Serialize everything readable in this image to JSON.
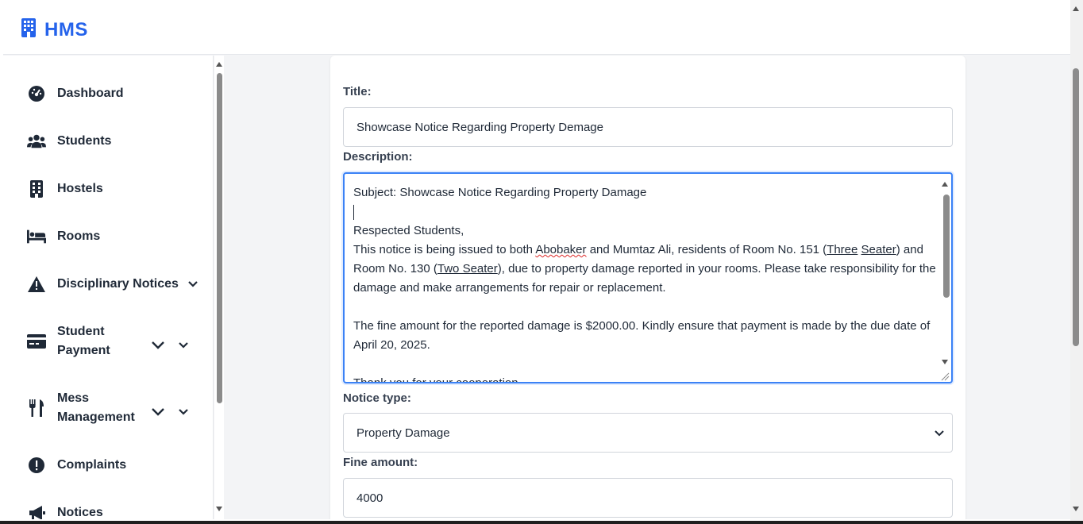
{
  "brand": {
    "name": "HMS",
    "icon": "building-icon",
    "color": "#2563eb"
  },
  "sidebar": {
    "items": [
      {
        "label": "Dashboard",
        "icon": "gauge-icon"
      },
      {
        "label": "Students",
        "icon": "users-icon"
      },
      {
        "label": "Hostels",
        "icon": "building-icon"
      },
      {
        "label": "Rooms",
        "icon": "bed-icon"
      },
      {
        "label": "Disciplinary Notices",
        "icon": "warning-icon"
      },
      {
        "label_line1": "Student",
        "label_line2": "Payment",
        "icon": "credit-card-icon"
      },
      {
        "label_line1": "Mess",
        "label_line2": "Management",
        "icon": "utensils-icon"
      },
      {
        "label": "Complaints",
        "icon": "exclamation-circle-icon"
      },
      {
        "label": "Notices",
        "icon": "megaphone-icon"
      }
    ]
  },
  "form": {
    "title_label": "Title:",
    "title_value": "Showcase Notice Regarding Property Demage",
    "description_label": "Description:",
    "description": {
      "line1": "Subject: Showcase Notice Regarding Property Damage",
      "line2": "Respected Students,",
      "para_part1": "This notice is being issued to both ",
      "para_name1": "Abobaker",
      "para_part2": " and Mumtaz Ali, residents of Room No. 151 (",
      "para_three": "Three",
      "para_seater1": "Seater",
      "para_part3": ") and Room No. 130 (",
      "para_two_seater": "Two Seater",
      "para_part4": "), due to property damage reported in your rooms. Please take responsibility for the damage and make arrangements for repair or replacement.",
      "fine_para": "The fine amount for the reported damage is $2000.00. Kindly ensure that payment is made by the due date of April 20, 2025.",
      "closing": "Thank you for your cooperation."
    },
    "notice_type_label": "Notice type:",
    "notice_type_value": "Property Damage",
    "fine_amount_label": "Fine amount:",
    "fine_amount_value": "4000"
  }
}
